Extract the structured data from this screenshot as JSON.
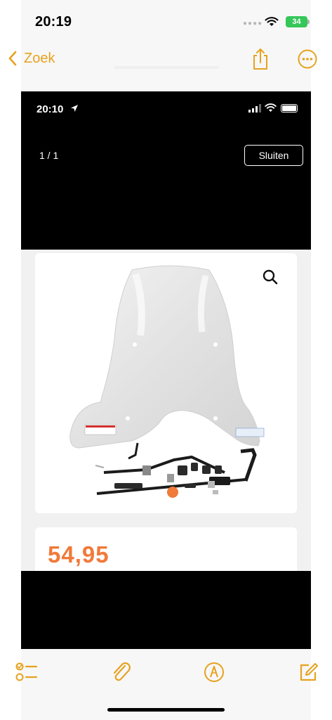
{
  "status_bar": {
    "time": "20:19",
    "battery": "34",
    "colors": {
      "battery": "#34c759"
    }
  },
  "nav": {
    "back_label": "Zoek",
    "accent": "#e7a21f"
  },
  "embedded_screenshot": {
    "status_time": "20:10",
    "counter": "1 / 1",
    "close_label": "Sluiten",
    "price": "54,95",
    "price_color": "#f07a3a"
  },
  "toolbar": {
    "items": [
      "checklist-icon",
      "paperclip-icon",
      "markup-pen-icon",
      "compose-icon"
    ]
  }
}
